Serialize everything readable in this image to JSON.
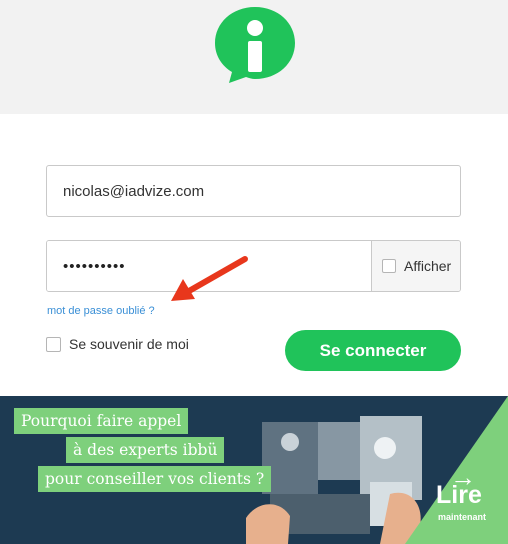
{
  "brand": {
    "logo_icon": "iadvize-speech-bubble-i-logo",
    "accent_color": "#20c35a"
  },
  "form": {
    "email_value": "nicolas@iadvize.com",
    "password_value": "••••••••••",
    "show_password_label": "Afficher",
    "forgot_password_link": "mot de passe oublié ?",
    "remember_me_label": "Se souvenir de moi",
    "submit_label": "Se connecter"
  },
  "annotation": {
    "icon": "red-arrow-icon",
    "color": "#e8371c"
  },
  "banner": {
    "lines": [
      "Pourquoi faire appel",
      "à des experts ibbü",
      "pour conseiller vos clients ?"
    ],
    "cta_title": "Lire",
    "cta_subtitle": "maintenant",
    "cta_icon": "right-arrow-icon",
    "background_color": "#1d3a52",
    "highlight_color": "#7ed07c"
  }
}
